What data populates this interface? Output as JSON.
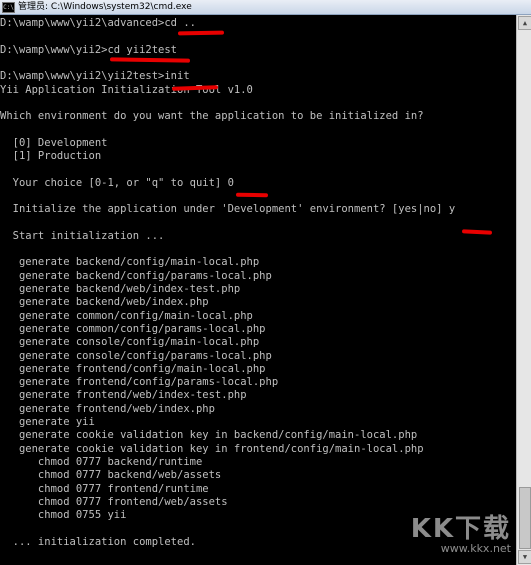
{
  "window": {
    "title_prefix": "管理员:",
    "title_path": "C:\\Windows\\system32\\cmd.exe",
    "icon_name": "cmd-icon",
    "icon_glyph": "C:\\"
  },
  "console": {
    "lines": [
      "D:\\wamp\\www\\yii2\\advanced>cd ..",
      "",
      "D:\\wamp\\www\\yii2>cd yii2test",
      "",
      "D:\\wamp\\www\\yii2\\yii2test>init",
      "Yii Application Initialization Tool v1.0",
      "",
      "Which environment do you want the application to be initialized in?",
      "",
      "  [0] Development",
      "  [1] Production",
      "",
      "  Your choice [0-1, or \"q\" to quit] 0",
      "",
      "  Initialize the application under 'Development' environment? [yes|no] y",
      "",
      "  Start initialization ...",
      "",
      "   generate backend/config/main-local.php",
      "   generate backend/config/params-local.php",
      "   generate backend/web/index-test.php",
      "   generate backend/web/index.php",
      "   generate common/config/main-local.php",
      "   generate common/config/params-local.php",
      "   generate console/config/main-local.php",
      "   generate console/config/params-local.php",
      "   generate frontend/config/main-local.php",
      "   generate frontend/config/params-local.php",
      "   generate frontend/web/index-test.php",
      "   generate frontend/web/index.php",
      "   generate yii",
      "   generate cookie validation key in backend/config/main-local.php",
      "   generate cookie validation key in frontend/config/main-local.php",
      "      chmod 0777 backend/runtime",
      "      chmod 0777 backend/web/assets",
      "      chmod 0777 frontend/runtime",
      "      chmod 0777 frontend/web/assets",
      "      chmod 0755 yii",
      "",
      "  ... initialization completed."
    ],
    "text_color": "#c0c0c0",
    "background": "#000000",
    "annotation_color": "#e80000"
  },
  "scrollbar": {
    "up_icon": "triangle-up-icon",
    "down_icon": "triangle-down-icon"
  },
  "watermark": {
    "logo": "KK下载",
    "url": "www.kkx.net"
  }
}
